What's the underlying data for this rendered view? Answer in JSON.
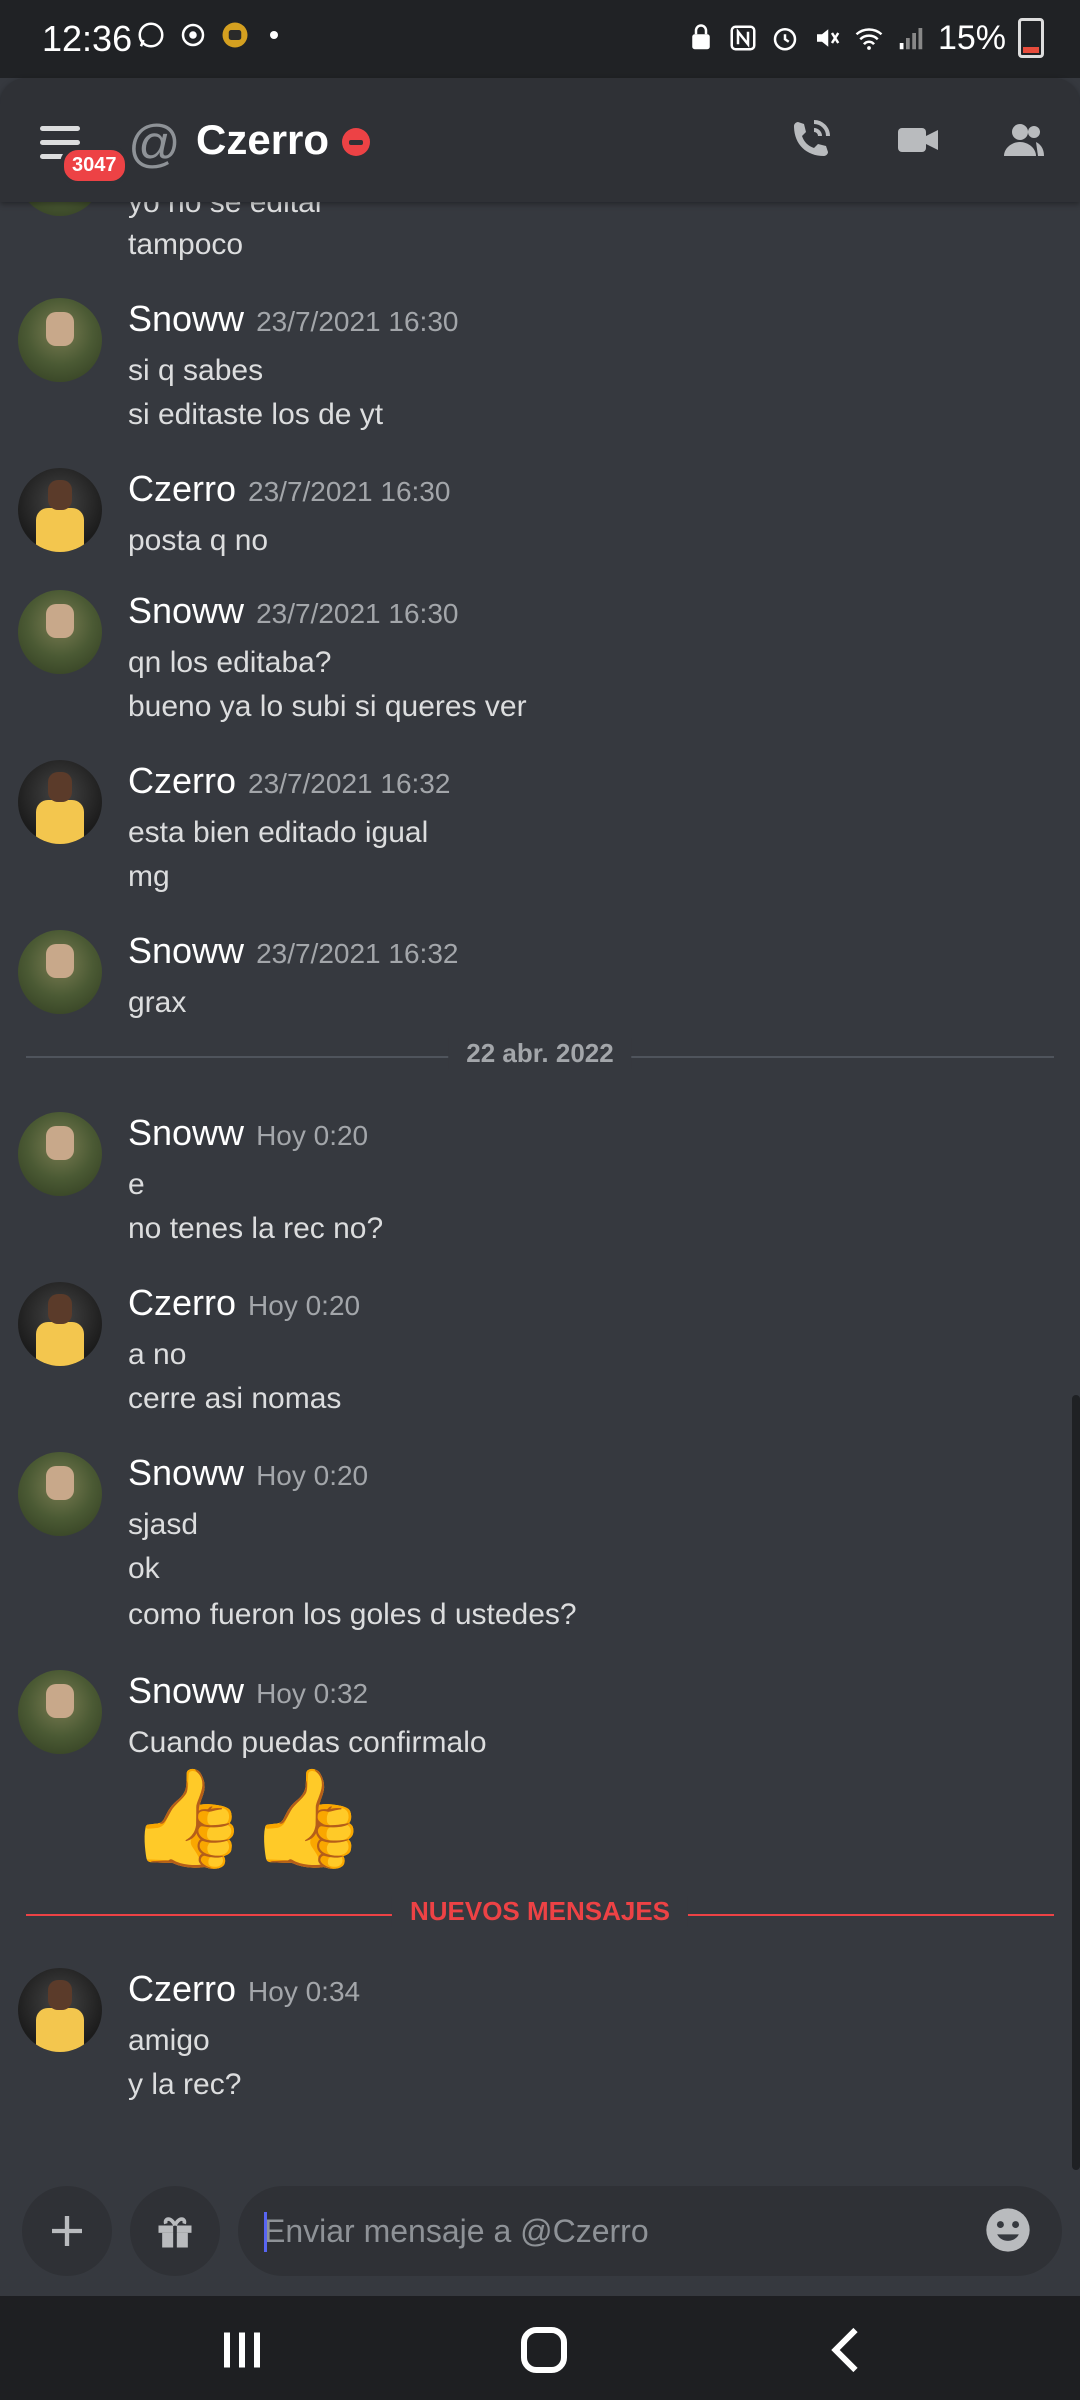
{
  "status_bar": {
    "time": "12:36",
    "battery": "15%"
  },
  "header": {
    "unread_badge": "3047",
    "at_symbol": "@",
    "title": "Czerro"
  },
  "fragment": {
    "lines": [
      "yo no se editar",
      "tampoco"
    ]
  },
  "messages": [
    {
      "author": "Snoww",
      "time": "23/7/2021 16:30",
      "lines": [
        "si q sabes",
        "si editaste los de yt"
      ]
    },
    {
      "author": "Czerro",
      "time": "23/7/2021 16:30",
      "lines": [
        "posta q no"
      ]
    },
    {
      "author": "Snoww",
      "time": "23/7/2021 16:30",
      "lines": [
        "qn los editaba?",
        "bueno ya lo subi si queres ver"
      ]
    },
    {
      "author": "Czerro",
      "time": "23/7/2021 16:32",
      "lines": [
        "esta bien editado igual",
        "mg"
      ]
    },
    {
      "author": "Snoww",
      "time": "23/7/2021 16:32",
      "lines": [
        "grax"
      ]
    },
    {
      "author": "Snoww",
      "time": "Hoy 0:20",
      "lines": [
        "e",
        "no tenes la rec no?"
      ]
    },
    {
      "author": "Czerro",
      "time": "Hoy 0:20",
      "lines": [
        "a no",
        "cerre asi nomas"
      ]
    },
    {
      "author": "Snoww",
      "time": "Hoy 0:20",
      "lines": [
        "sjasd",
        "ok",
        "como fueron los goles d ustedes?"
      ]
    },
    {
      "author": "Snoww",
      "time": "Hoy 0:32",
      "lines": [
        "Cuando puedas confirmalo"
      ],
      "emoji": "👍👍"
    },
    {
      "author": "Czerro",
      "time": "Hoy 0:34",
      "lines": [
        "amigo",
        "y la rec?"
      ]
    }
  ],
  "date_divider": "22 abr. 2022",
  "new_messages_divider": "NUEVOS MENSAJES",
  "composer": {
    "placeholder": "Enviar mensaje a @Czerro"
  }
}
